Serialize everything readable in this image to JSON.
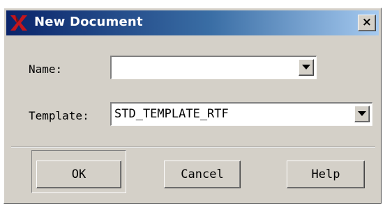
{
  "window": {
    "title": "New Document",
    "close_label": "×"
  },
  "form": {
    "name": {
      "label": "Name:",
      "value": ""
    },
    "template": {
      "label": "Template:",
      "value": "STD_TEMPLATE_RTF"
    }
  },
  "buttons": {
    "ok": "OK",
    "cancel": "Cancel",
    "help": "Help"
  },
  "icons": {
    "app": "x-logo-icon",
    "dropdown": "triangle-down-icon"
  },
  "colors": {
    "titlebar_start": "#0a246a",
    "titlebar_end": "#a6caf0",
    "dialog_bg": "#d4d0c8",
    "logo": "#c4161c"
  }
}
